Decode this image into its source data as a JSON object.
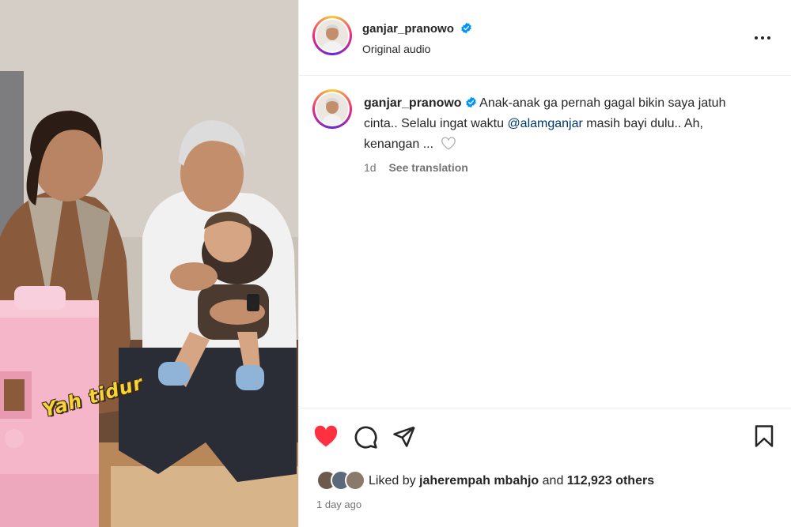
{
  "media": {
    "sticker_text": "Yah tidur"
  },
  "post": {
    "username": "ganjar_pranowo",
    "audio_label": "Original audio"
  },
  "caption": {
    "username": "ganjar_pranowo",
    "text_before": "Anak-anak ga pernah gagal bikin saya jatuh cinta.. Selalu ingat waktu ",
    "mention": "@alamganjar",
    "text_after": " masih bayi dulu.. Ah, kenangan ...",
    "age": "1d",
    "see_translation": "See translation"
  },
  "likes": {
    "prefix": "Liked by ",
    "user1": "jaherempah",
    "user2": "mbahjo",
    "middle": " and ",
    "count": "112,923 others"
  },
  "timestamp": "1 day ago",
  "colors": {
    "like_red": "#ff3040",
    "verified_blue": "#0095f6",
    "mention_blue": "#00376b"
  },
  "icons": [
    "verified-badge-icon",
    "more-options-icon",
    "like-heart-icon",
    "comment-icon",
    "share-icon",
    "save-bookmark-icon",
    "caption-heart-icon"
  ]
}
